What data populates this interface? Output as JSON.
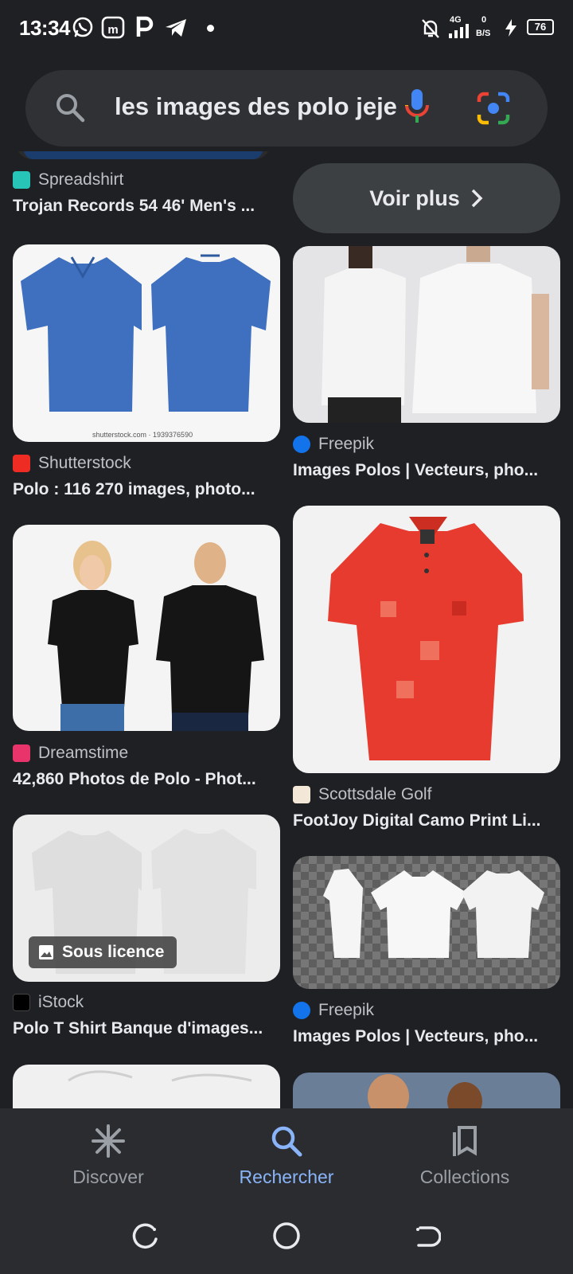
{
  "status_bar": {
    "time": "13:34",
    "network": "4G",
    "data_rate_value": "0",
    "data_rate_unit": "B/S",
    "battery": "76"
  },
  "search": {
    "query": "les images des polo jeje"
  },
  "voir_plus": "Voir plus",
  "results": [
    {
      "source": "Spreadshirt",
      "title": "Trojan Records 54 46' Men's ..."
    },
    {
      "source": "Shutterstock",
      "title": "Polo : 116 270 images, photo...",
      "watermark": "shutterstock.com · 1939376590"
    },
    {
      "source": "Freepik",
      "title": "Images Polos | Vecteurs, pho..."
    },
    {
      "source": "Dreamstime",
      "title": "42,860 Photos de Polo - Phot..."
    },
    {
      "source": "Scottsdale Golf",
      "title": "FootJoy Digital Camo Print Li..."
    },
    {
      "source": "iStock",
      "title": "Polo T Shirt Banque d'images...",
      "badge": "Sous licence"
    },
    {
      "source": "Freepik",
      "title": "Images Polos | Vecteurs, pho..."
    }
  ],
  "bottom_nav": {
    "discover": "Discover",
    "search": "Rechercher",
    "collections": "Collections"
  },
  "colors": {
    "background": "#1f2024",
    "accent": "#8ab4f8"
  }
}
